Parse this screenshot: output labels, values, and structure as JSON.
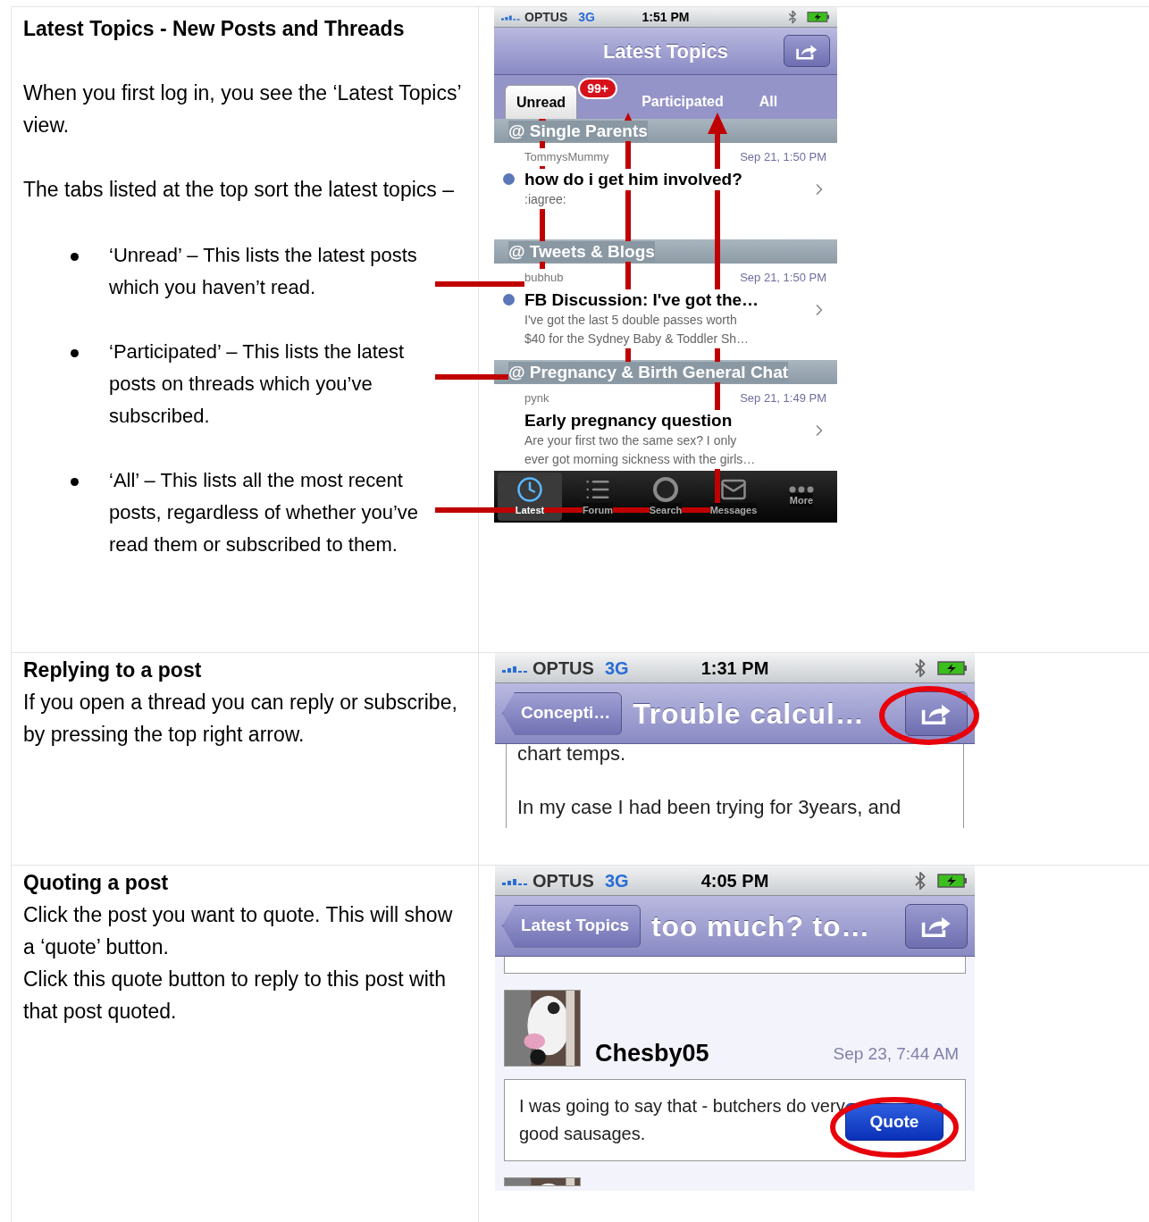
{
  "rows": [
    {
      "heading": "Latest Topics - New Posts and Threads",
      "paragraphs": [
        "When you first log in, you see the ‘Latest Topics’ view.",
        "The tabs listed at the top sort the latest topics –"
      ],
      "bullets": [
        "‘Unread’ – This lists the latest posts which you haven’t read.",
        "‘Participated’ – This lists the latest posts on threads which you’ve subscribed.",
        "‘All’ – This lists all the most recent posts, regardless of whether you’ve read them or subscribed to them."
      ]
    },
    {
      "heading": "Replying to a post",
      "paragraphs": [
        "If you open a thread you can reply or subscribe, by pressing the top right arrow."
      ]
    },
    {
      "heading": "Quoting a post",
      "paragraphs": [
        "Click the post you want to quote. This will show a ‘quote’ button.",
        "Click this quote button to reply to this post with that post quoted."
      ]
    }
  ],
  "latest_screen": {
    "status": {
      "carrier": "OPTUS",
      "network": "3G",
      "time": "1:51 PM"
    },
    "title": "Latest Topics",
    "tabs": [
      {
        "label": "Unread",
        "selected": true,
        "badge": "99+"
      },
      {
        "label": "Participated",
        "selected": false
      },
      {
        "label": "All",
        "selected": false
      }
    ],
    "groups": [
      {
        "forum": "@ Single Parents",
        "topics": [
          {
            "author": "TommysMummy",
            "date": "Sep 21, 1:50 PM",
            "title": "how do i get him involved?",
            "preview": [
              ":iagree:"
            ],
            "unread": true
          }
        ]
      },
      {
        "forum": "@ Tweets & Blogs",
        "topics": [
          {
            "author": "bubhub",
            "date": "Sep 21, 1:50 PM",
            "title": "FB Discussion:  I've got the…",
            "preview": [
              "I've got the last 5 double passes worth",
              "$40 for the Sydney Baby & Toddler Sh…"
            ],
            "unread": true
          }
        ]
      },
      {
        "forum": "@ Pregnancy & Birth General Chat",
        "topics": [
          {
            "author": "pynk",
            "date": "Sep 21, 1:49 PM",
            "title": "Early pregnancy question",
            "preview": [
              "Are your first two the same sex? I only",
              "ever got morning sickness with the girls…"
            ],
            "unread": false
          }
        ]
      }
    ],
    "tab_bar": [
      {
        "kind": "clock",
        "label": "Latest",
        "selected": true
      },
      {
        "kind": "list",
        "label": "Forum",
        "selected": false
      },
      {
        "kind": "search",
        "label": "Search",
        "selected": false
      },
      {
        "kind": "mail",
        "label": "Messages",
        "selected": false
      },
      {
        "kind": "more",
        "label": "More",
        "selected": false
      }
    ]
  },
  "reply_screen": {
    "status": {
      "carrier": "OPTUS",
      "network": "3G",
      "time": "1:31 PM"
    },
    "back": "Concepti…",
    "title": "Trouble calcul…",
    "body": [
      "chart temps.",
      "In my case I had been trying for 3years, and"
    ]
  },
  "quote_screen": {
    "status": {
      "carrier": "OPTUS",
      "network": "3G",
      "time": "4:05 PM"
    },
    "back": "Latest Topics",
    "title": "too much? to…",
    "post": {
      "author": "Chesby05",
      "date": "Sep 23, 7:44 AM",
      "text": "I was going to say that - butchers do very good sausages.",
      "button": "Quote"
    }
  }
}
